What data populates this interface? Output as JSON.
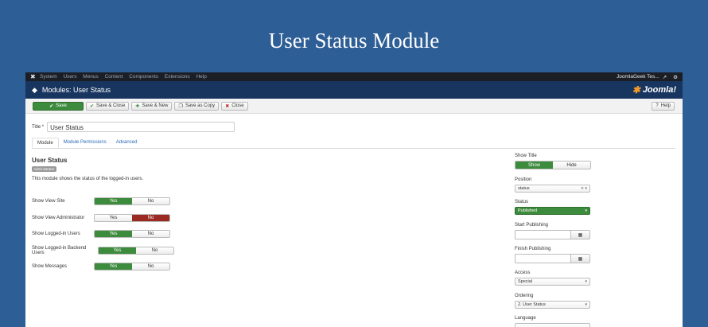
{
  "banner": {
    "title": "User Status Module"
  },
  "topbar": {
    "menu": [
      "System",
      "Users",
      "Menus",
      "Content",
      "Components",
      "Extensions",
      "Help"
    ],
    "site_name": "JoomlaGeek Tes...",
    "external_icon": "↗",
    "gear_icon": "⚙"
  },
  "header": {
    "title": "Modules: User Status",
    "logo_text": "Joomla!"
  },
  "toolbar": {
    "save": "Save",
    "save_close": "Save & Close",
    "save_new": "Save & New",
    "save_copy": "Save as Copy",
    "close": "Close",
    "help": "Help"
  },
  "form": {
    "title_label": "Title *",
    "title_value": "User Status"
  },
  "tabs": [
    "Module",
    "Module Permissions",
    "Advanced"
  ],
  "module": {
    "name": "User Status",
    "badge": "Administrator",
    "description": "This module shows the status of the logged-in users."
  },
  "options": [
    {
      "label": "Show View Site",
      "yes": "Yes",
      "no": "No",
      "value": "yes"
    },
    {
      "label": "Show View Administrator",
      "yes": "Yes",
      "no": "No",
      "value": "no"
    },
    {
      "label": "Show Logged-in Users",
      "yes": "Yes",
      "no": "No",
      "value": "yes"
    },
    {
      "label": "Show Logged-in Backend Users",
      "yes": "Yes",
      "no": "No",
      "value": "yes"
    },
    {
      "label": "Show Messages",
      "yes": "Yes",
      "no": "No",
      "value": "yes"
    }
  ],
  "right": {
    "show_title_label": "Show Title",
    "show": "Show",
    "hide": "Hide",
    "position_label": "Position",
    "position_value": "status",
    "status_label": "Status",
    "status_value": "Published",
    "start_label": "Start Publishing",
    "finish_label": "Finish Publishing",
    "access_label": "Access",
    "access_value": "Special",
    "ordering_label": "Ordering",
    "ordering_value": "2. User Status",
    "language_label": "Language"
  },
  "colors": {
    "background": "#2e5e96",
    "header": "#18355f",
    "success": "#3d8b3d",
    "danger": "#9a2a22"
  }
}
